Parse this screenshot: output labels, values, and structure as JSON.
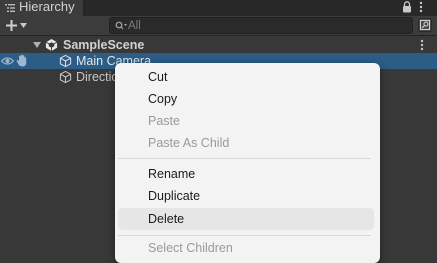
{
  "window": {
    "tab_title": "Hierarchy",
    "tab_icon": "hierarchy-list-icon",
    "lock_icon": "lock-icon",
    "menu_icon": "vertical-dots-icon"
  },
  "toolbar": {
    "add_icon": "plus-icon",
    "dropdown_icon": "caret-down-icon",
    "search_placeholder": "All",
    "search_icon": "search-icon",
    "scene_search_icon": "scene-search-icon"
  },
  "tree": {
    "scene": {
      "label": "SampleScene",
      "expanded": true
    },
    "items": [
      {
        "label": "Main Camera",
        "selected": true
      },
      {
        "label": "Directional Light",
        "selected": false
      }
    ]
  },
  "context_menu": {
    "items": [
      {
        "label": "Cut",
        "enabled": true
      },
      {
        "label": "Copy",
        "enabled": true
      },
      {
        "label": "Paste",
        "enabled": false
      },
      {
        "label": "Paste As Child",
        "enabled": false
      },
      {
        "label": "Rename",
        "enabled": true
      },
      {
        "label": "Duplicate",
        "enabled": true
      },
      {
        "label": "Delete",
        "enabled": true,
        "highlighted": true
      },
      {
        "label": "Select Children",
        "enabled": false
      }
    ]
  },
  "colors": {
    "panel_bg": "#383838",
    "selection": "#2c5d87",
    "menu_bg": "#f3f3f3",
    "menu_hover": "#e6e6e6"
  }
}
